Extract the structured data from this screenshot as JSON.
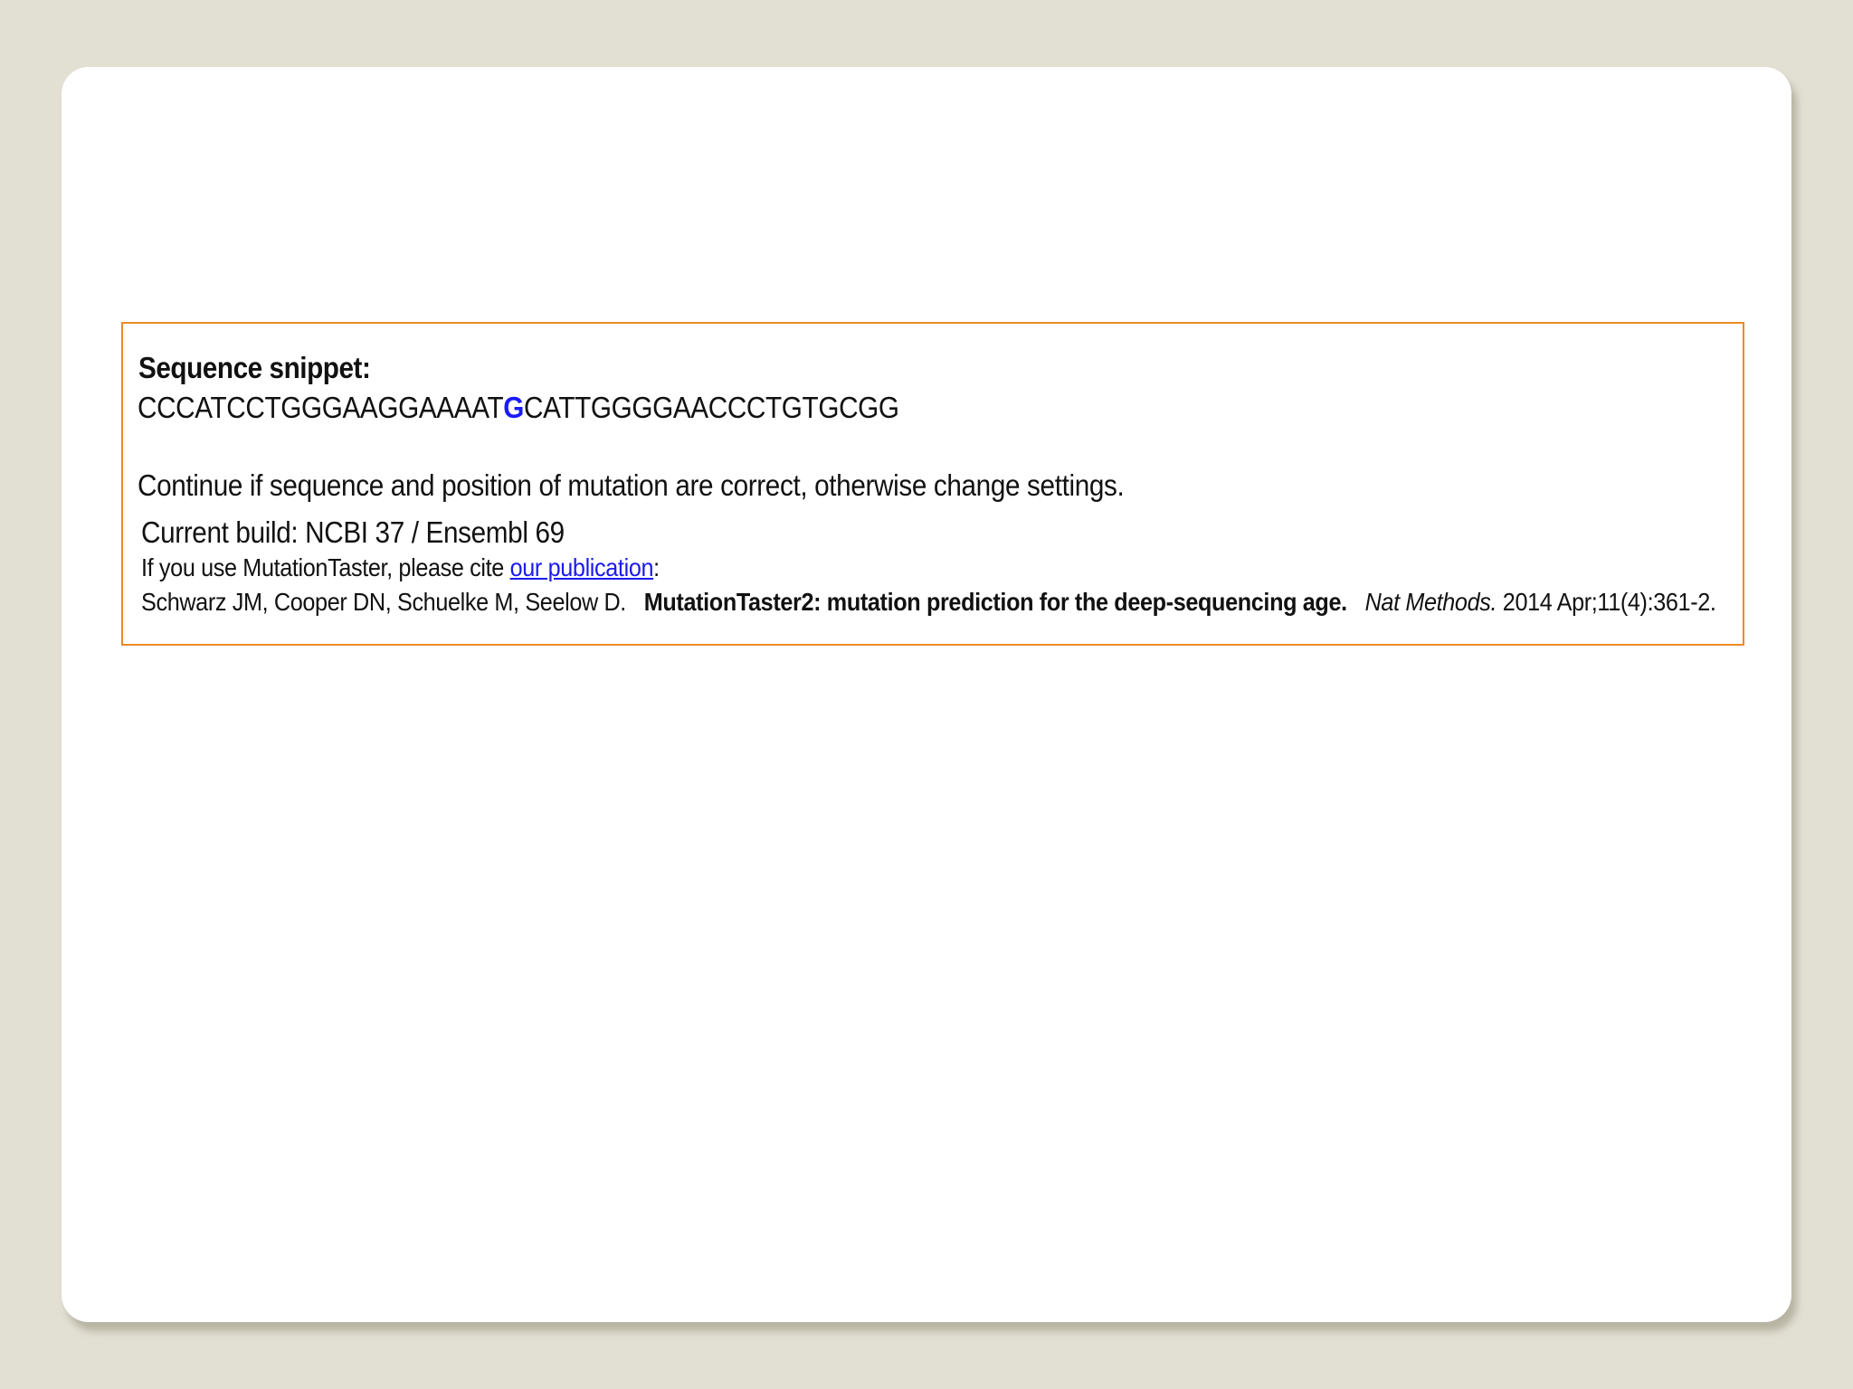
{
  "panel": {
    "heading": "Sequence snippet:",
    "sequence": {
      "before": "CCCATCCTGGGAAGGAAAAT",
      "mutated_base": "G",
      "after": "CATTGGGGAACCCTGTGCGG"
    },
    "instruction": "Continue if sequence and position of mutation are correct, otherwise change settings.",
    "build": "Current build: NCBI 37 / Ensembl 69",
    "cite": {
      "prefix": "If you use MutationTaster, please cite",
      "link": "our publication",
      "suffix": ":"
    },
    "reference": {
      "authors": "Schwarz JM, Cooper DN, Schuelke M, Seelow D.",
      "title": "MutationTaster2: mutation prediction for the deep-sequencing age.",
      "journal": "Nat Methods.",
      "details": "2014 Apr;11(4):361-2."
    }
  },
  "colors": {
    "background": "#e2dfd3",
    "panel_border": "#ec8a23",
    "mutated_base": "#1a1aff",
    "link": "#1a1aee"
  }
}
